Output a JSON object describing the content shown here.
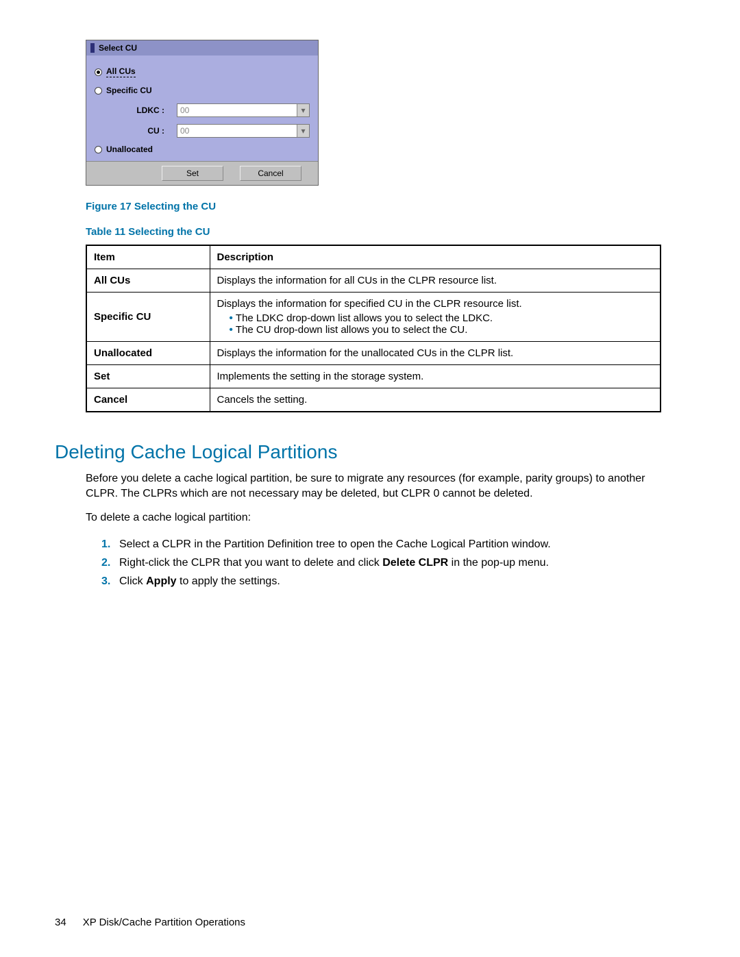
{
  "dialog": {
    "title": "Select CU",
    "radio_all": "All CUs",
    "radio_specific": "Specific CU",
    "ldkc_label": "LDKC :",
    "ldkc_value": "00",
    "cu_label": "CU :",
    "cu_value": "00",
    "radio_unallocated": "Unallocated",
    "set_btn": "Set",
    "cancel_btn": "Cancel"
  },
  "figure_caption": "Figure 17 Selecting the CU",
  "table_caption": "Table 11 Selecting the CU",
  "table": {
    "head_item": "Item",
    "head_desc": "Description",
    "rows": [
      {
        "item": "All CUs",
        "desc": "Displays the information for all CUs in the CLPR resource list."
      },
      {
        "item": "Specific CU",
        "desc": "Displays the information for specified CU in the CLPR resource list.",
        "bullets": [
          "The LDKC drop-down list allows you to select the LDKC.",
          "The CU drop-down list allows you to select the CU."
        ]
      },
      {
        "item": "Unallocated",
        "desc": "Displays the information for the unallocated CUs in the CLPR list."
      },
      {
        "item": "Set",
        "desc": "Implements the setting in the storage system."
      },
      {
        "item": "Cancel",
        "desc": "Cancels the setting."
      }
    ]
  },
  "section_heading": "Deleting Cache Logical Partitions",
  "para1": "Before you delete a cache logical partition, be sure to migrate any resources (for example, parity groups) to another CLPR. The CLPRs which are not necessary may be deleted, but CLPR 0 cannot be deleted.",
  "para2": "To delete a cache logical partition:",
  "steps": {
    "s1": "Select a CLPR in the Partition Definition tree to open the Cache Logical Partition window.",
    "s2a": "Right-click the CLPR that you want to delete and click ",
    "s2b": "Delete CLPR",
    "s2c": " in the pop-up menu.",
    "s3a": "Click ",
    "s3b": "Apply",
    "s3c": " to apply the settings."
  },
  "footer": {
    "page": "34",
    "title": "XP Disk/Cache Partition Operations"
  }
}
